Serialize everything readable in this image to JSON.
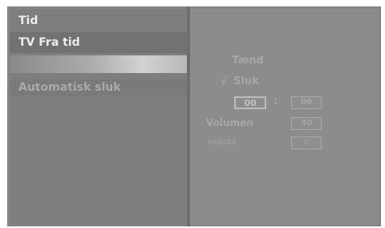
{
  "left_menu": {
    "title": "Tid",
    "selected": "TV Fra tid",
    "sub_item": "Automatisk  sluk"
  },
  "right_panel": {
    "option_on": "Tænd",
    "check_mark": "√",
    "option_off": "Sluk",
    "time_hours": "00",
    "time_sep": ":",
    "time_minutes": "00",
    "volume_label": "Volumen",
    "volume_value": "30",
    "setting_label": "Indstil",
    "setting_value": "0"
  }
}
